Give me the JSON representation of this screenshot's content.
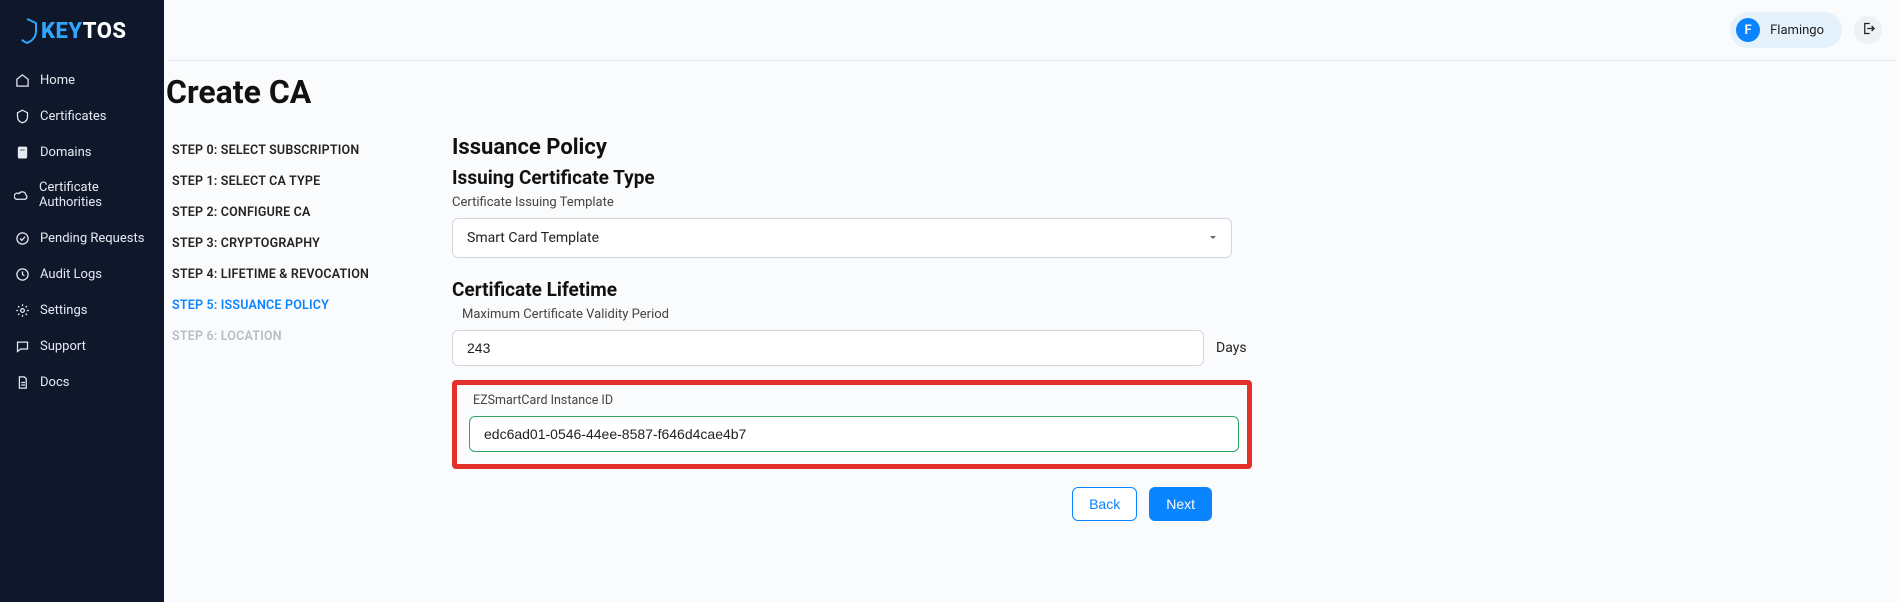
{
  "brand": {
    "name_accent": "KEY",
    "name_rest": "TOS"
  },
  "sidebar": {
    "items": [
      {
        "label": "Home"
      },
      {
        "label": "Certificates"
      },
      {
        "label": "Domains"
      },
      {
        "label": "Certificate Authorities"
      },
      {
        "label": "Pending Requests"
      },
      {
        "label": "Audit Logs"
      },
      {
        "label": "Settings"
      },
      {
        "label": "Support"
      },
      {
        "label": "Docs"
      }
    ]
  },
  "topbar": {
    "user_initial": "F",
    "user_name": "Flamingo"
  },
  "page": {
    "title": "Create CA"
  },
  "wizard": {
    "steps": [
      {
        "label": "STEP 0: SELECT SUBSCRIPTION",
        "state": "normal"
      },
      {
        "label": "STEP 1: SELECT CA TYPE",
        "state": "normal"
      },
      {
        "label": "STEP 2: CONFIGURE CA",
        "state": "normal"
      },
      {
        "label": "STEP 3: CRYPTOGRAPHY",
        "state": "normal"
      },
      {
        "label": "STEP 4: LIFETIME & REVOCATION",
        "state": "normal"
      },
      {
        "label": "STEP 5: ISSUANCE POLICY",
        "state": "active"
      },
      {
        "label": "STEP 6: LOCATION",
        "state": "disabled"
      }
    ]
  },
  "form": {
    "section_title": "Issuance Policy",
    "cert_type_title": "Issuing Certificate Type",
    "template_label": "Certificate Issuing Template",
    "template_value": "Smart Card Template",
    "lifetime_title": "Certificate Lifetime",
    "validity_label": "Maximum Certificate Validity Period",
    "validity_value": "243",
    "validity_unit": "Days",
    "instance_label": "EZSmartCard Instance ID",
    "instance_value": "edc6ad01-0546-44ee-8587-f646d4cae4b7",
    "back_label": "Back",
    "next_label": "Next"
  }
}
